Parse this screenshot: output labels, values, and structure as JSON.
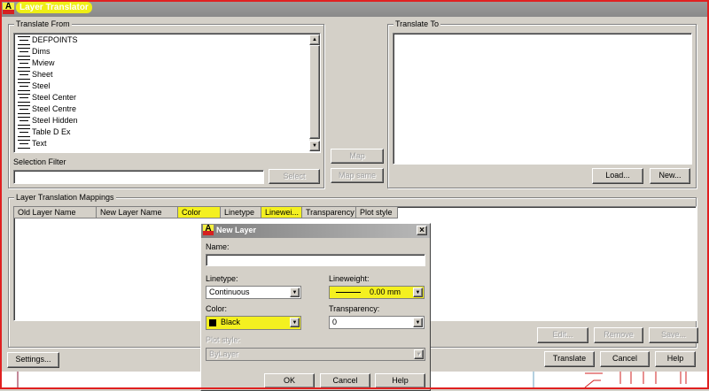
{
  "window": {
    "title": "Layer Translator"
  },
  "translate_from": {
    "label": "Translate From",
    "layers": [
      "DEFPOINTS",
      "Dims",
      "Mview",
      "Sheet",
      "Steel",
      "Steel Center",
      "Steel Centre",
      "Steel Hidden",
      "Table D Ex",
      "Text"
    ],
    "filter_label": "Selection Filter",
    "filter_value": "",
    "select_button": "Select"
  },
  "middle": {
    "map_button": "Map",
    "map_same_button": "Map same"
  },
  "translate_to": {
    "label": "Translate To",
    "load_button": "Load...",
    "new_button": "New..."
  },
  "mappings": {
    "label": "Layer Translation Mappings",
    "columns": [
      "Old Layer Name",
      "New Layer Name",
      "Color",
      "Linetype",
      "Linewei...",
      "Transparency",
      "Plot style"
    ],
    "edit_button": "Edit...",
    "remove_button": "Remove",
    "save_button": "Save..."
  },
  "footer": {
    "settings_button": "Settings...",
    "translate_button": "Translate",
    "cancel_button": "Cancel",
    "help_button": "Help"
  },
  "new_layer": {
    "title": "New Layer",
    "close": "×",
    "name_label": "Name:",
    "name_value": "",
    "linetype_label": "Linetype:",
    "linetype_value": "Continuous",
    "lineweight_label": "Lineweight:",
    "lineweight_value": "0.00 mm",
    "color_label": "Color:",
    "color_value": "Black",
    "transparency_label": "Transparency:",
    "transparency_value": "0",
    "plotstyle_label": "Plot style:",
    "plotstyle_value": "ByLayer",
    "ok_button": "OK",
    "cancel_button": "Cancel",
    "help_button": "Help"
  }
}
